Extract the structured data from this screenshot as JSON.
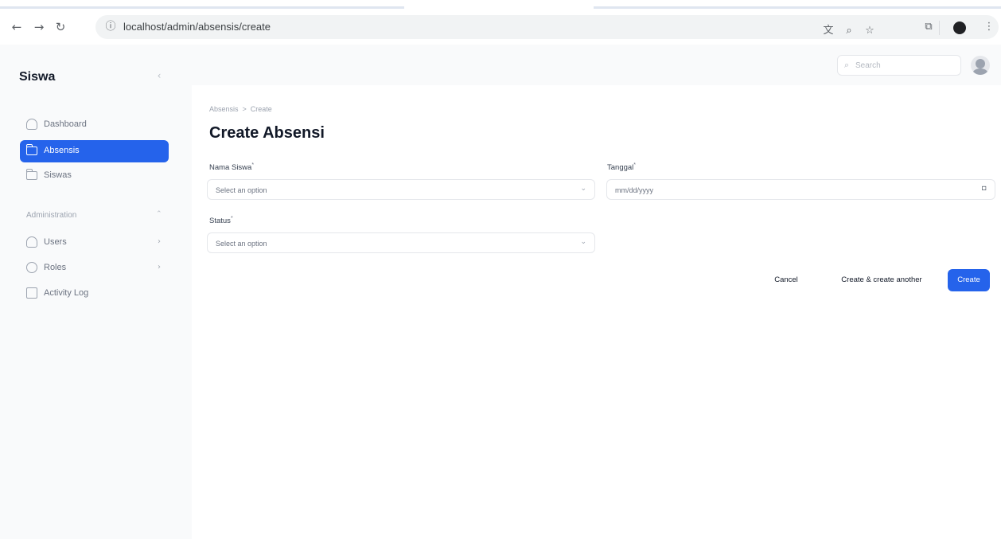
{
  "browser": {
    "url": "localhost/admin/absensis/create",
    "back_icon": "←",
    "forward_icon": "→",
    "reload_icon": "↻",
    "info_icon": "ⓘ",
    "translate_icon": "文",
    "zoom_icon": "⌕",
    "bookmark_icon": "☆",
    "extensions_icon": "⧉",
    "menu_icon": "⋮"
  },
  "sidebar": {
    "brand": "Siswa",
    "collapse_icon": "‹",
    "items": [
      {
        "label": "Dashboard",
        "icon": "home-icon"
      },
      {
        "label": "Absensis",
        "icon": "folder-icon"
      },
      {
        "label": "Siswas",
        "icon": "folder-icon"
      }
    ],
    "group": {
      "label": "Administration",
      "chevron": "⌃",
      "items": [
        {
          "label": "Users",
          "icon": "users-icon",
          "chevron": "›"
        },
        {
          "label": "Roles",
          "icon": "shield-icon",
          "chevron": "›"
        },
        {
          "label": "Activity Log",
          "icon": "log-icon"
        }
      ]
    }
  },
  "topbar": {
    "search_placeholder": "Search",
    "search_icon": "⌕"
  },
  "main": {
    "breadcrumb": {
      "parent": "Absensis",
      "separator": ">",
      "current": "Create"
    },
    "title": "Create Absensi",
    "form": {
      "nama_siswa": {
        "label": "Nama Siswa",
        "required": "*",
        "value": "Select an option"
      },
      "tanggal": {
        "label": "Tanggal",
        "required": "*",
        "value": "mm/dd/yyyy",
        "icon": "▫"
      },
      "status": {
        "label": "Status",
        "required": "*",
        "value": "Select an option"
      },
      "dropdown_icon": "⌄"
    },
    "actions": {
      "cancel": "Cancel",
      "create_another": "Create & create another",
      "create": "Create"
    }
  },
  "colors": {
    "accent": "#2563eb",
    "background": "#f9fafb"
  }
}
